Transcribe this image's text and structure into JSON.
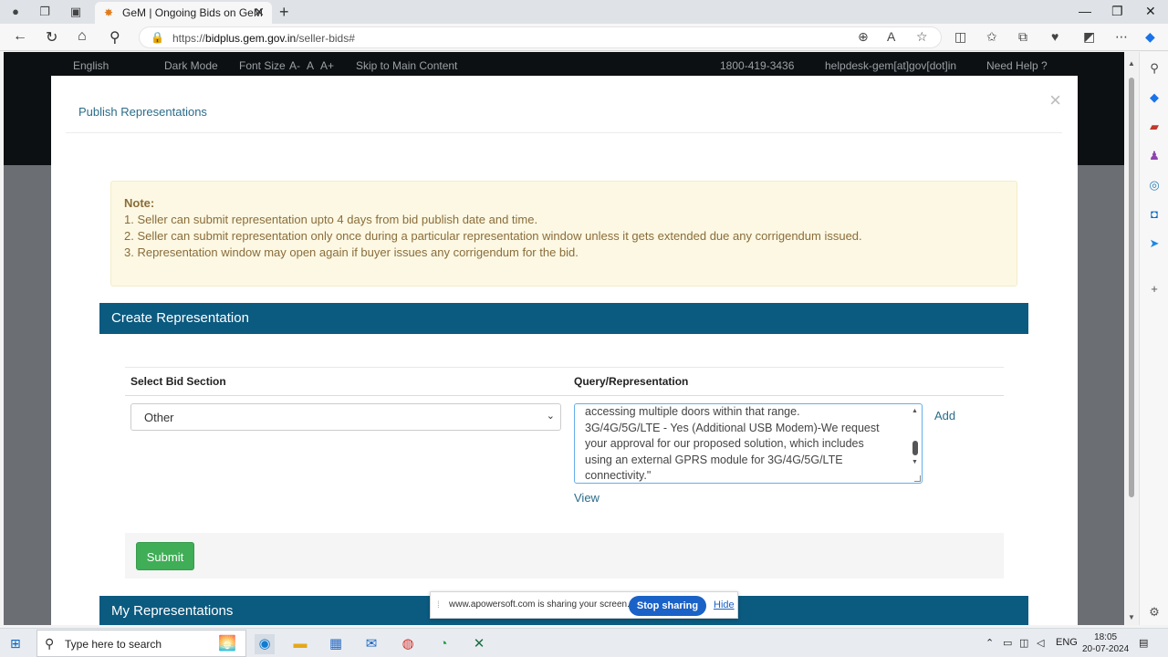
{
  "browser": {
    "tab_title": "GeM | Ongoing Bids on GeM",
    "url_prefix": "https://",
    "url_domain": "bidplus.gem.gov.in",
    "url_path": "/seller-bids#"
  },
  "site_header": {
    "language": "English",
    "dark_mode": "Dark Mode",
    "font_size": "Font Size",
    "font_small": "A-",
    "font_normal": "A",
    "font_large": "A+",
    "skip_link": "Skip to Main Content",
    "phone": "1800-419-3436",
    "email": "helpdesk-gem[at]gov[dot]in",
    "need_help": "Need Help ?"
  },
  "modal": {
    "title": "Publish Representations",
    "close": "×",
    "note": {
      "heading": "Note:",
      "lines": [
        "1. Seller can submit representation upto 4 days from bid publish date and time.",
        "2. Seller can submit representation only once during a particular representation window unless it gets extended due any corrigendum issued.",
        "3. Representation window may open again if buyer issues any corrigendum for the bid."
      ]
    },
    "create_header": "Create Representation",
    "form": {
      "section_label": "Select Bid Section",
      "query_label": "Query/Representation",
      "section_value": "Other",
      "query_lines": [
        "accessing multiple doors within that range.",
        "3G/4G/5G/LTE - Yes (Additional USB Modem)-We request",
        "your approval for our proposed solution, which includes",
        "using an external GPRS module for 3G/4G/5G/LTE",
        "connectivity.\""
      ],
      "add_label": "Add",
      "view_label": "View",
      "submit_label": "Submit"
    },
    "my_rep_header": "My Representations"
  },
  "share_banner": {
    "message": "www.apowersoft.com is sharing your screen.",
    "stop_label": "Stop sharing",
    "hide_label": "Hide"
  },
  "taskbar": {
    "search_placeholder": "Type here to search",
    "lang": "ENG",
    "time": "18:05",
    "date": "20-07-2024"
  }
}
